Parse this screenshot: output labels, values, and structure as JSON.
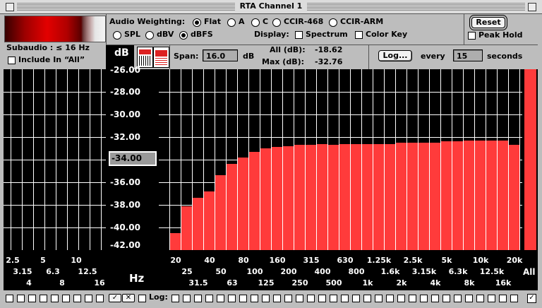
{
  "window": {
    "title": "RTA Channel 1"
  },
  "subaudio": {
    "label": "Subaudio : ≤ 16 Hz",
    "include_label": "Include In “All”"
  },
  "weighting": {
    "label": "Audio Weighting:",
    "options": [
      "Flat",
      "A",
      "C",
      "CCIR-468",
      "CCIR-ARM"
    ],
    "selected": "Flat"
  },
  "units": {
    "options": [
      "SPL",
      "dBV",
      "dBFS"
    ],
    "selected": "dBFS"
  },
  "display": {
    "label": "Display:",
    "spectrum_label": "Spectrum",
    "colorkey_label": "Color Key"
  },
  "reset_label": "Reset",
  "peak_hold_label": "Peak Hold",
  "db_label": "dB",
  "span": {
    "label": "Span:",
    "value": "16.0",
    "unit": "dB"
  },
  "levels": {
    "all_label": "All (dB):",
    "all_value": "-18.62",
    "max_label": "Max (dB):",
    "max_value": "-32.76"
  },
  "log": {
    "button_label": "Log...",
    "every_label": "every",
    "interval": "15",
    "seconds_label": "seconds"
  },
  "cursor_value": "-34.00",
  "hz_label": "Hz",
  "all_bar_label": "All",
  "bottom": {
    "log_label": "Log:"
  },
  "colors": {
    "bar": "#ff3b3b",
    "grid": "#ffffff",
    "panel": "#000000"
  },
  "chart_data": {
    "type": "bar",
    "ylim": [
      -42,
      -26
    ],
    "yticks": [
      "-26.00",
      "-28.00",
      "-30.00",
      "-32.00",
      "-34.00",
      "-36.00",
      "-38.00",
      "-40.00",
      "-42.00"
    ],
    "subaudio_ticks": [
      {
        "label": "2.5",
        "row": 0
      },
      {
        "label": "5",
        "row": 0
      },
      {
        "label": "10",
        "row": 0
      },
      {
        "label": "3.15",
        "row": 1
      },
      {
        "label": "6.3",
        "row": 1
      },
      {
        "label": "12.5",
        "row": 1
      },
      {
        "label": "4",
        "row": 2
      },
      {
        "label": "8",
        "row": 2
      },
      {
        "label": "16",
        "row": 2
      }
    ],
    "categories": [
      "20",
      "25",
      "31.5",
      "40",
      "50",
      "63",
      "80",
      "100",
      "125",
      "160",
      "200",
      "250",
      "315",
      "400",
      "500",
      "630",
      "800",
      "1k",
      "1.25k",
      "1.6k",
      "2k",
      "2.5k",
      "3.15k",
      "4k",
      "5k",
      "6.3k",
      "8k",
      "10k",
      "12.5k",
      "16k",
      "20k"
    ],
    "values": [
      -40.5,
      -38.1,
      -37.4,
      -36.8,
      -35.4,
      -34.4,
      -33.8,
      -33.3,
      -33.0,
      -32.9,
      -32.8,
      -32.7,
      -32.7,
      -32.6,
      -32.7,
      -32.6,
      -32.6,
      -32.6,
      -32.6,
      -32.6,
      -32.5,
      -32.5,
      -32.5,
      -32.5,
      -32.4,
      -32.4,
      -32.3,
      -32.3,
      -32.3,
      -32.3,
      -32.7
    ],
    "all_value": -26.0
  }
}
